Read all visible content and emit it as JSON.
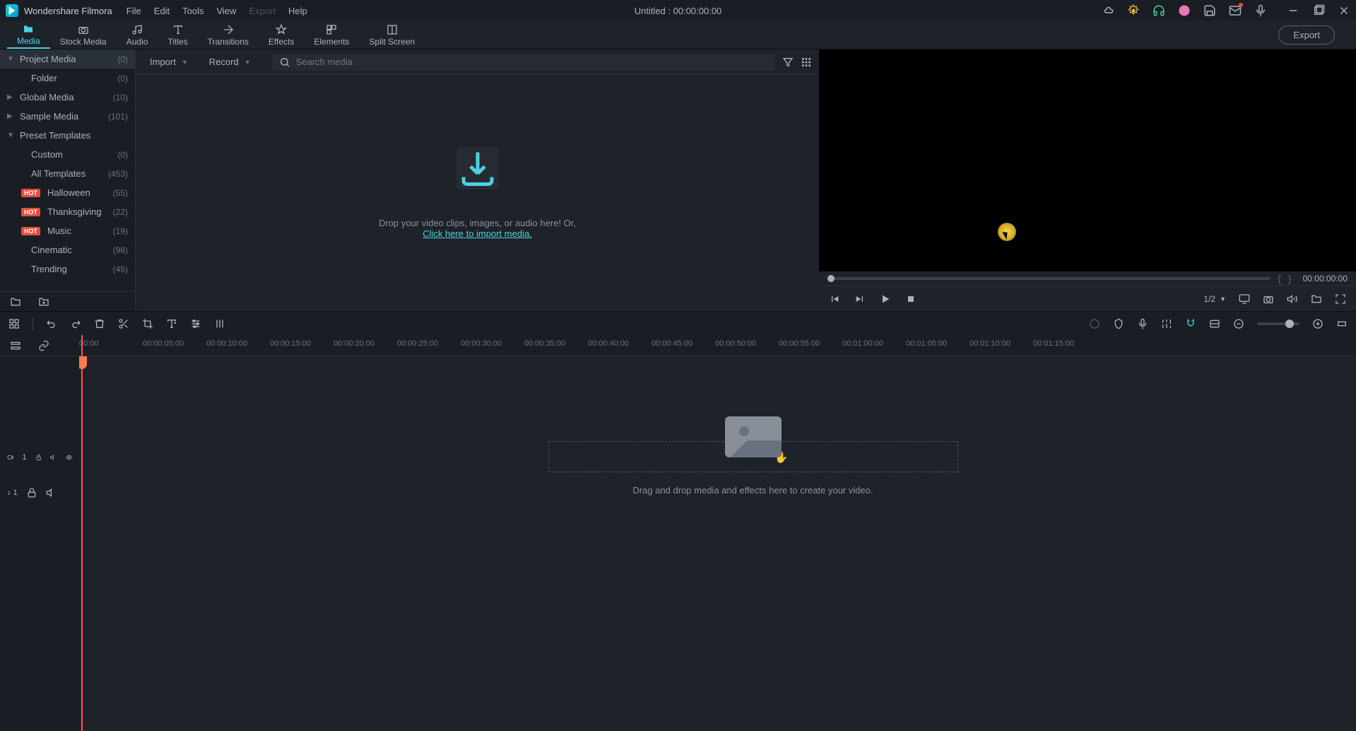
{
  "app": {
    "name": "Wondershare Filmora",
    "title": "Untitled : 00:00:00:00"
  },
  "menu": {
    "file": "File",
    "edit": "Edit",
    "tools": "Tools",
    "view": "View",
    "export": "Export",
    "help": "Help"
  },
  "tabs": {
    "media": "Media",
    "stock": "Stock Media",
    "audio": "Audio",
    "titles": "Titles",
    "transitions": "Transitions",
    "effects": "Effects",
    "elements": "Elements",
    "split": "Split Screen",
    "export_btn": "Export"
  },
  "sidebar": {
    "items": [
      {
        "label": "Project Media",
        "count": "(0)",
        "arrow": "▼",
        "selected": true
      },
      {
        "label": "Folder",
        "count": "(0)",
        "indent": true
      },
      {
        "label": "Global Media",
        "count": "(10)",
        "arrow": "▶"
      },
      {
        "label": "Sample Media",
        "count": "(101)",
        "arrow": "▶"
      },
      {
        "label": "Preset Templates",
        "count": "",
        "arrow": "▼"
      },
      {
        "label": "Custom",
        "count": "(0)",
        "indent": true
      },
      {
        "label": "All Templates",
        "count": "(453)",
        "indent": true
      },
      {
        "label": "Halloween",
        "count": "(55)",
        "indent2": true,
        "hot": true
      },
      {
        "label": "Thanksgiving",
        "count": "(22)",
        "indent2": true,
        "hot": true
      },
      {
        "label": "Music",
        "count": "(19)",
        "indent2": true,
        "hot": true
      },
      {
        "label": "Cinematic",
        "count": "(98)",
        "indent": true
      },
      {
        "label": "Trending",
        "count": "(45)",
        "indent": true
      }
    ],
    "hot": "HOT"
  },
  "media": {
    "import": "Import",
    "record": "Record",
    "search_placeholder": "Search media",
    "drop_text": "Drop your video clips, images, or audio here! Or,",
    "drop_link": "Click here to import media."
  },
  "preview": {
    "time": "00:00:00:00",
    "scale": "1/2"
  },
  "ruler": [
    "00:00",
    "00:00:05:00",
    "00:00:10:00",
    "00:00:15:00",
    "00:00:20:00",
    "00:00:25:00",
    "00:00:30:00",
    "00:00:35:00",
    "00:00:40:00",
    "00:00:45:00",
    "00:00:50:00",
    "00:00:55:00",
    "00:01:00:00",
    "00:01:05:00",
    "00:01:10:00",
    "00:01:15:00"
  ],
  "timeline": {
    "hint": "Drag and drop media and effects here to create your video.",
    "video_track": "1",
    "audio_track": "♪ 1"
  }
}
